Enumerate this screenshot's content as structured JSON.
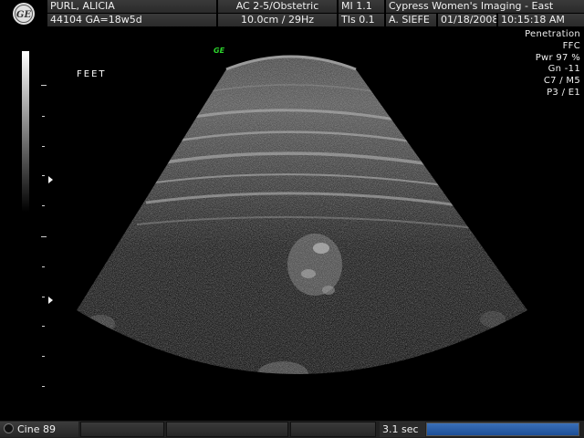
{
  "header": {
    "patient_name": "PURL, ALICIA",
    "patient_id": "44104  GA=18w5d",
    "probe_exam": "AC 2-5/Obstetric",
    "depth_rate": "10.0cm / 29Hz",
    "mi": "MI  1.1",
    "tis": "TIs  0.1",
    "institution": "Cypress Women's Imaging - East",
    "operator": "A. SIEFE",
    "date": "01/18/2008",
    "time": "10:15:18 AM"
  },
  "readout": {
    "lines": [
      "Penetration",
      "FFC",
      "Pwr  97 %",
      "Gn  -11",
      "C7 / M5",
      "P3 / E1"
    ]
  },
  "image": {
    "annotation": "FEET",
    "probe_orientation_mark": "GE"
  },
  "bottom": {
    "cine_label": "Cine 89",
    "cine_duration": "3.1 sec",
    "cine_progress": 1.0
  },
  "colors": {
    "accent_blue": "#2a5fa8",
    "ge_mark_green": "#2cd32c"
  }
}
